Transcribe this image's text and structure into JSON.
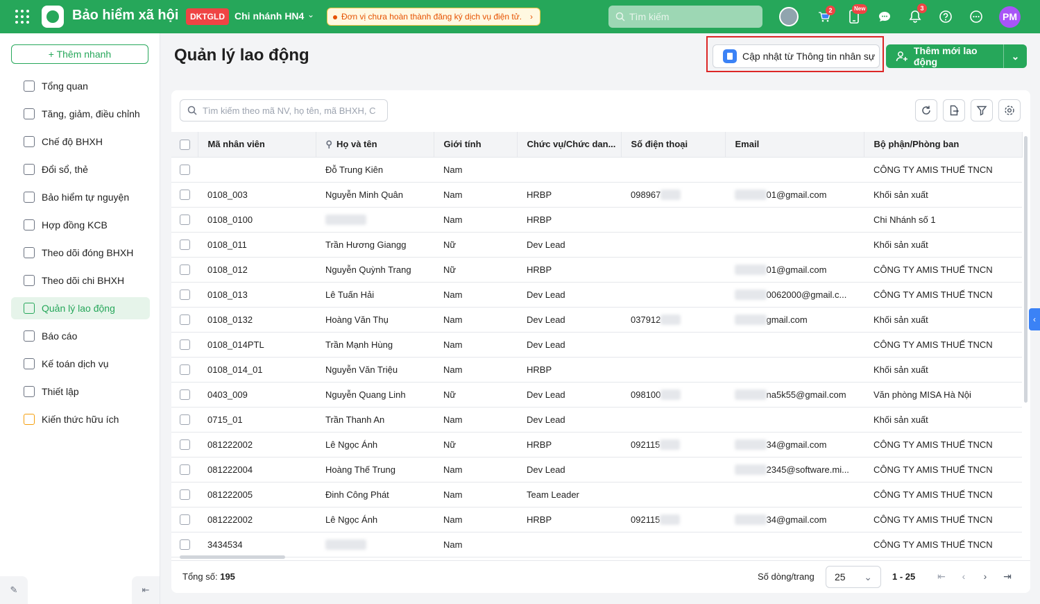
{
  "topbar": {
    "app_title": "Bảo hiểm xã hội",
    "code_badge": "DKTGLD",
    "branch": "Chi nhánh HN4",
    "notice": "Đơn vị chưa hoàn thành đăng ký dịch vụ điện tử.",
    "search_placeholder": "Tìm kiếm",
    "cart_badge": "2",
    "new_badge": "New",
    "bell_badge": "3",
    "user_initials": "PM",
    "brand_color": "#26a75a"
  },
  "sidebar": {
    "quick_add": "Thêm nhanh",
    "items": [
      {
        "label": "Tổng quan",
        "icon": "home-icon"
      },
      {
        "label": "Tăng, giảm, điều chỉnh",
        "icon": "user-adjust-icon"
      },
      {
        "label": "Chế độ BHXH",
        "icon": "shield-heart-icon"
      },
      {
        "label": "Đổi sổ, thẻ",
        "icon": "card-swap-icon"
      },
      {
        "label": "Bảo hiểm tự nguyện",
        "icon": "shield-icon"
      },
      {
        "label": "Hợp đồng KCB",
        "icon": "contract-icon"
      },
      {
        "label": "Theo dõi đóng BHXH",
        "icon": "tracking-pay-icon"
      },
      {
        "label": "Theo dõi chi BHXH",
        "icon": "tracking-spend-icon"
      },
      {
        "label": "Quản lý lao động",
        "icon": "users-icon"
      },
      {
        "label": "Báo cáo",
        "icon": "report-icon"
      },
      {
        "label": "Kế toán dịch vụ",
        "icon": "accounting-icon"
      },
      {
        "label": "Thiết lập",
        "icon": "settings-icon"
      },
      {
        "label": "Kiến thức hữu ích",
        "icon": "knowledge-icon"
      }
    ]
  },
  "header": {
    "title": "Quản lý lao động",
    "sync_button": "Cập nhật từ Thông tin nhân sự",
    "add_button": "Thêm mới lao động"
  },
  "grid": {
    "search_placeholder": "Tìm kiếm theo mã NV, họ tên, mã BHXH, C",
    "columns": [
      "Mã nhân viên",
      "Họ và tên",
      "Giới tính",
      "Chức vụ/Chức dan...",
      "Số điện thoại",
      "Email",
      "Bộ phận/Phòng ban"
    ],
    "rows": [
      {
        "code": "",
        "name": "Đỗ Trung Kiên",
        "gender": "Nam",
        "position": "",
        "phone": "",
        "email": "",
        "dept": "CÔNG TY AMIS THUẾ TNCN"
      },
      {
        "code": "0108_003",
        "name": "Nguyễn Minh Quân",
        "gender": "Nam",
        "position": "HRBP",
        "phone": "098967",
        "email": "01@gmail.com",
        "dept": "Khối sản xuất"
      },
      {
        "code": "0108_0100",
        "name": "",
        "gender": "Nam",
        "position": "HRBP",
        "phone": "",
        "email": "",
        "dept": "Chi Nhánh số 1"
      },
      {
        "code": "0108_011",
        "name": "Trần Hương Giangg",
        "gender": "Nữ",
        "position": "Dev Lead",
        "phone": "",
        "email": "",
        "dept": "Khối sản xuất"
      },
      {
        "code": "0108_012",
        "name": "Nguyễn Quỳnh Trang",
        "gender": "Nữ",
        "position": "HRBP",
        "phone": "",
        "email": "01@gmail.com",
        "dept": "CÔNG TY AMIS THUẾ TNCN"
      },
      {
        "code": "0108_013",
        "name": "Lê Tuấn Hải",
        "gender": "Nam",
        "position": "Dev Lead",
        "phone": "",
        "email": "0062000@gmail.c...",
        "dept": "CÔNG TY AMIS THUẾ TNCN"
      },
      {
        "code": "0108_0132",
        "name": "Hoàng Văn Thụ",
        "gender": "Nam",
        "position": "Dev Lead",
        "phone": "037912",
        "email": "gmail.com",
        "dept": "Khối sản xuất"
      },
      {
        "code": "0108_014PTL",
        "name": "Trần Mạnh Hùng",
        "gender": "Nam",
        "position": "Dev Lead",
        "phone": "",
        "email": "",
        "dept": "CÔNG TY AMIS THUẾ TNCN"
      },
      {
        "code": "0108_014_01",
        "name": "Nguyễn Văn Triệu",
        "gender": "Nam",
        "position": "HRBP",
        "phone": "",
        "email": "",
        "dept": "Khối sản xuất"
      },
      {
        "code": "0403_009",
        "name": "Nguyễn Quang Linh",
        "gender": "Nữ",
        "position": "Dev Lead",
        "phone": "098100",
        "email": "na5k55@gmail.com",
        "dept": "Văn phòng MISA Hà Nội"
      },
      {
        "code": "0715_01",
        "name": "Trần Thanh An",
        "gender": "Nam",
        "position": "Dev Lead",
        "phone": "",
        "email": "",
        "dept": "Khối sản xuất"
      },
      {
        "code": "081222002",
        "name": "Lê Ngọc Ánh",
        "gender": "Nữ",
        "position": "HRBP",
        "phone": "092115",
        "email": "34@gmail.com",
        "dept": "CÔNG TY AMIS THUẾ TNCN"
      },
      {
        "code": "081222004",
        "name": "Hoàng Thế Trung",
        "gender": "Nam",
        "position": "Dev Lead",
        "phone": "",
        "email": "2345@software.mi...",
        "dept": "CÔNG TY AMIS THUẾ TNCN"
      },
      {
        "code": "081222005",
        "name": "Đinh Công Phát",
        "gender": "Nam",
        "position": "Team Leader",
        "phone": "",
        "email": "",
        "dept": "CÔNG TY AMIS THUẾ TNCN"
      },
      {
        "code": "081222002",
        "name": "Lê Ngọc Ánh",
        "gender": "Nam",
        "position": "HRBP",
        "phone": "092115",
        "email": "34@gmail.com",
        "dept": "CÔNG TY AMIS THUẾ TNCN"
      },
      {
        "code": "3434534",
        "name": "",
        "gender": "Nam",
        "position": "",
        "phone": "",
        "email": "",
        "dept": "CÔNG TY AMIS THUẾ TNCN"
      }
    ],
    "blurred": [
      {
        "name": false,
        "phone": false,
        "email": false
      },
      {
        "name": false,
        "phone": true,
        "email": true
      },
      {
        "name": true,
        "phone": false,
        "email": false
      },
      {
        "name": false,
        "phone": false,
        "email": false
      },
      {
        "name": false,
        "phone": false,
        "email": true
      },
      {
        "name": false,
        "phone": false,
        "email": true
      },
      {
        "name": false,
        "phone": true,
        "email": true
      },
      {
        "name": false,
        "phone": false,
        "email": false
      },
      {
        "name": false,
        "phone": false,
        "email": false
      },
      {
        "name": false,
        "phone": true,
        "email": true
      },
      {
        "name": false,
        "phone": false,
        "email": false
      },
      {
        "name": false,
        "phone": true,
        "email": true
      },
      {
        "name": false,
        "phone": false,
        "email": true
      },
      {
        "name": false,
        "phone": false,
        "email": false
      },
      {
        "name": false,
        "phone": true,
        "email": true
      },
      {
        "name": true,
        "phone": false,
        "email": false
      }
    ]
  },
  "footer": {
    "total_label": "Tổng số:",
    "total_value": "195",
    "rows_label": "Số dòng/trang",
    "rows_value": "25",
    "range": "1 - 25"
  }
}
